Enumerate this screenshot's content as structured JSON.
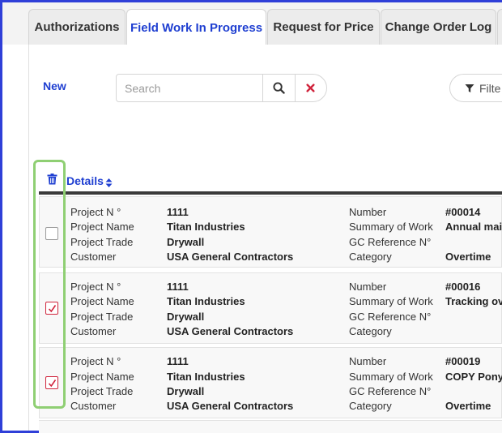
{
  "tabs": [
    {
      "label": "Authorizations",
      "active": false
    },
    {
      "label": "Field Work In Progress",
      "active": true
    },
    {
      "label": "Request for Price",
      "active": false
    },
    {
      "label": "Change Order Log",
      "active": false
    }
  ],
  "toolbar": {
    "new_label": "New",
    "search_placeholder": "Search",
    "filter_label": "Filte"
  },
  "list": {
    "header_label": "Details",
    "field_labels": {
      "project_no": "Project N °",
      "project_name": "Project Name",
      "project_trade": "Project Trade",
      "customer": "Customer",
      "number": "Number",
      "summary": "Summary of Work",
      "gc_ref": "GC Reference N°",
      "category": "Category"
    },
    "rows": [
      {
        "checked": false,
        "project_no": "1111",
        "project_name": "Titan Industries",
        "project_trade": "Drywall",
        "customer": "USA General Contractors",
        "number": "#00014",
        "summary": "Annual main",
        "gc_ref": "",
        "category": "Overtime"
      },
      {
        "checked": true,
        "project_no": "1111",
        "project_name": "Titan Industries",
        "project_trade": "Drywall",
        "customer": "USA General Contractors",
        "number": "#00016",
        "summary": "Tracking ov",
        "gc_ref": "",
        "category": ""
      },
      {
        "checked": true,
        "project_no": "1111",
        "project_name": "Titan Industries",
        "project_trade": "Drywall",
        "customer": "USA General Contractors",
        "number": "#00019",
        "summary": "COPY Pony",
        "gc_ref": "",
        "category": "Overtime"
      }
    ]
  },
  "colors": {
    "accent": "#1f3fd1",
    "danger": "#d0243c",
    "highlight": "#8fcf73"
  }
}
